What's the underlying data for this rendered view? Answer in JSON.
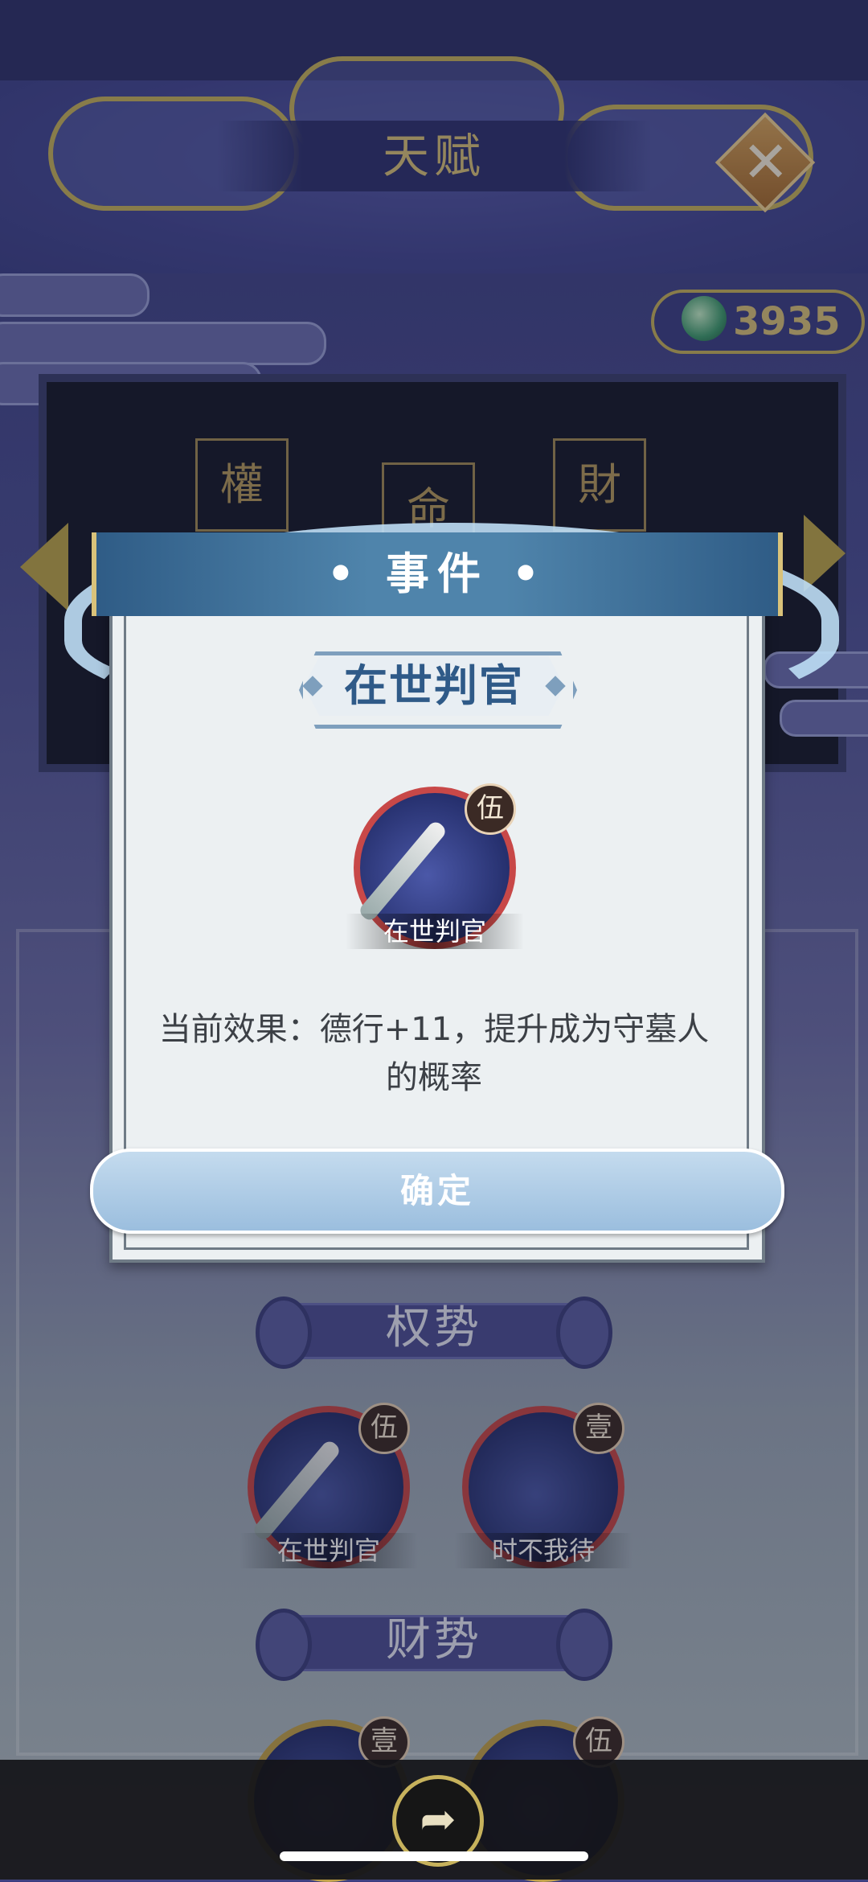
{
  "header": {
    "title": "天赋",
    "close_icon": "✕"
  },
  "currency": {
    "value": "3935",
    "icon": "jade-coin-icon"
  },
  "board": {
    "cells": [
      "權",
      "命",
      "財"
    ]
  },
  "dialog": {
    "title": "• 事件 •",
    "talent_name": "在世判官",
    "talent_icon_caption": "在世判官",
    "talent_level": "伍",
    "effect": "当前效果：德行+11，提升成为守墓人的概率",
    "confirm_label": "确定"
  },
  "sections": [
    {
      "title": "权势",
      "talents": [
        {
          "caption": "在世判官",
          "level": "伍"
        },
        {
          "caption": "时不我待",
          "level": "壹"
        }
      ]
    },
    {
      "title": "财势",
      "talents": [
        {
          "caption": "",
          "level": "壹"
        },
        {
          "caption": "",
          "level": "伍"
        }
      ]
    }
  ],
  "bottom_bar": {
    "share_icon": "share-icon"
  },
  "colors": {
    "accent_gold": "#c7b25c",
    "dialog_blue": "#4f84ab",
    "title_blue": "#2f5a88",
    "red_ring": "#c84848"
  }
}
